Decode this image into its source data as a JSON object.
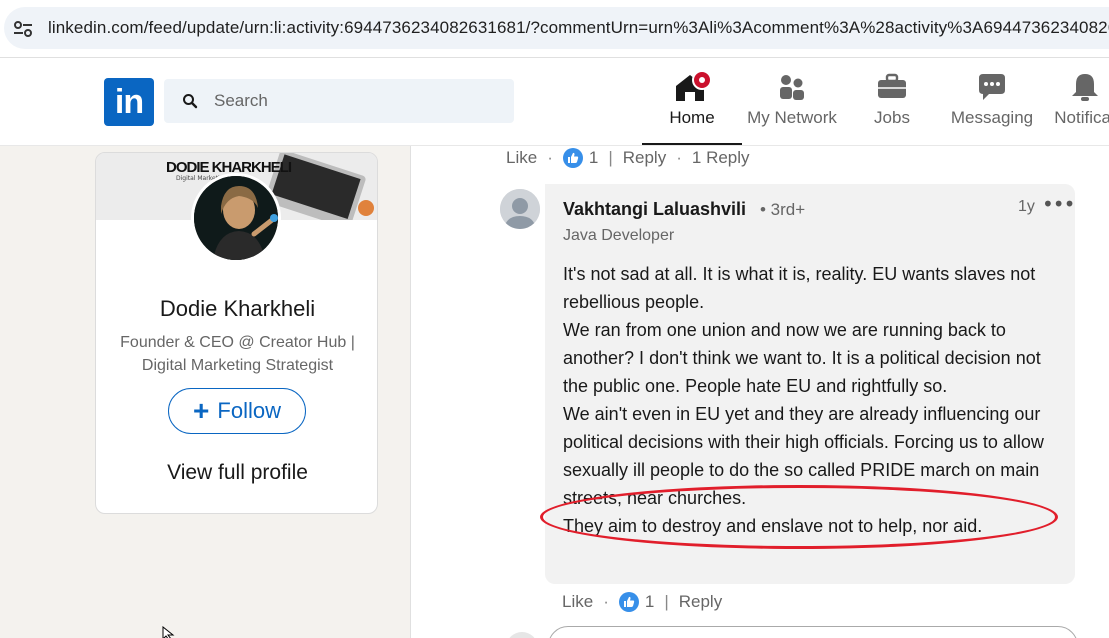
{
  "browser": {
    "url": "linkedin.com/feed/update/urn:li:activity:6944736234082631681/?commentUrn=urn%3Ali%3Acomment%3A%28activity%3A69447362340826"
  },
  "nav": {
    "logo_text": "in",
    "search_placeholder": "Search",
    "items": [
      {
        "label": "Home",
        "icon": "home-icon"
      },
      {
        "label": "My Network",
        "icon": "people-icon"
      },
      {
        "label": "Jobs",
        "icon": "briefcase-icon"
      },
      {
        "label": "Messaging",
        "icon": "chat-icon"
      },
      {
        "label": "Notificat",
        "icon": "bell-icon"
      }
    ],
    "home_badge_color": "#cb112d"
  },
  "profile": {
    "banner_title": "DODIE KHARKHELI",
    "banner_subtitle": "Digital Marketing",
    "name": "Dodie Kharkheli",
    "headline": "Founder & CEO @ Creator Hub | Digital Marketing Strategist",
    "follow_label": "Follow",
    "view_profile_label": "View full profile"
  },
  "top_actions": {
    "like_label": "Like",
    "like_count": "1",
    "reply_label": "Reply",
    "replies_label": "1 Reply"
  },
  "comment": {
    "author": "Vakhtangi Laluashvili",
    "degree": "• 3rd+",
    "title": "Java Developer",
    "time": "1y",
    "more": "•••",
    "lines": [
      "It's not sad at all. It is what it is, reality. EU wants slaves not rebellious people.",
      "We ran from one union and now we are running back to another? I don't think we want to. It is a political decision not the public one. People hate EU and rightfully so.",
      "We ain't even in EU yet and they are already influencing our political decisions with their high officials. Forcing us to allow sexually ill people to do the so called PRIDE march on main streets, near churches.",
      "They aim to destroy and enslave not to help, nor aid."
    ]
  },
  "bottom_actions": {
    "like_label": "Like",
    "like_count": "1",
    "reply_label": "Reply"
  },
  "colors": {
    "brand": "#0a66c2",
    "highlight": "#e11e2b"
  }
}
